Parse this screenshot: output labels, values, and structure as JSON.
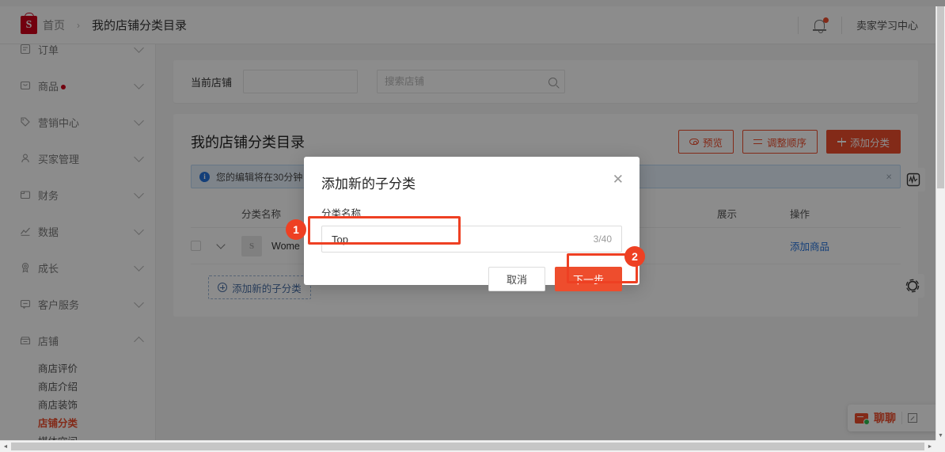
{
  "header": {
    "logo_glyph": "S",
    "breadcrumb_home": "首页",
    "breadcrumb_separator": "›",
    "breadcrumb_current": "我的店铺分类目录",
    "bell_icon": "notification-bell-icon",
    "seller_center": "卖家学习中心"
  },
  "sidebar": {
    "items": [
      {
        "label": "订单",
        "icon": "order-icon",
        "badge": false,
        "expanded": false
      },
      {
        "label": "商品",
        "icon": "product-icon",
        "badge": true,
        "expanded": false
      },
      {
        "label": "营销中心",
        "icon": "tag-icon",
        "badge": false,
        "expanded": false
      },
      {
        "label": "买家管理",
        "icon": "buyer-icon",
        "badge": false,
        "expanded": false
      },
      {
        "label": "财务",
        "icon": "finance-icon",
        "badge": false,
        "expanded": false
      },
      {
        "label": "数据",
        "icon": "chart-icon",
        "badge": false,
        "expanded": false
      },
      {
        "label": "成长",
        "icon": "growth-icon",
        "badge": false,
        "expanded": false
      },
      {
        "label": "客户服务",
        "icon": "support-icon",
        "badge": false,
        "expanded": false
      },
      {
        "label": "店铺",
        "icon": "shop-icon",
        "badge": false,
        "expanded": true
      }
    ],
    "sub_items": [
      {
        "label": "商店评价",
        "active": false
      },
      {
        "label": "商店介绍",
        "active": false
      },
      {
        "label": "商店装饰",
        "active": false
      },
      {
        "label": "店铺分类",
        "active": true
      },
      {
        "label": "媒体空间",
        "active": false
      }
    ]
  },
  "shop_filter": {
    "label": "当前店铺",
    "select_value": "",
    "search_placeholder": "搜索店铺",
    "search_value": "",
    "search_icon": "search-icon"
  },
  "panel": {
    "title": "我的店铺分类目录",
    "buttons": {
      "preview": "预览",
      "reorder": "调整顺序",
      "add_category": "添加分类"
    },
    "notice": "您的编辑将在30分钟",
    "notice_icon": "info-icon",
    "notice_close": "×"
  },
  "table": {
    "columns": [
      "分类名称",
      "展示",
      "操作"
    ],
    "rows": [
      {
        "name": "Wome",
        "thumb_glyph": "S",
        "toggle_on": false,
        "action": "添加商品"
      }
    ],
    "add_sub_button": "添加新的子分类"
  },
  "modal": {
    "title": "添加新的子分类",
    "close_icon": "close-icon",
    "field_label": "分类名称",
    "field_value": "Top",
    "field_placeholder": "",
    "char_count": "3/40",
    "cancel": "取消",
    "next": "下一步"
  },
  "annotations": {
    "badge_1": "1",
    "badge_2": "2",
    "highlight_color": "#ee4023"
  },
  "floating": {
    "graph_icon": "activity-graph-icon",
    "circle_icon": "loading-circle-icon",
    "chat_label": "聊聊",
    "chat_icon": "chat-icon",
    "chat_expand_icon": "expand-icon"
  },
  "scrollbars": {
    "v_up": "▲",
    "v_down": "▼",
    "h_left": "◄",
    "h_right": "►"
  }
}
